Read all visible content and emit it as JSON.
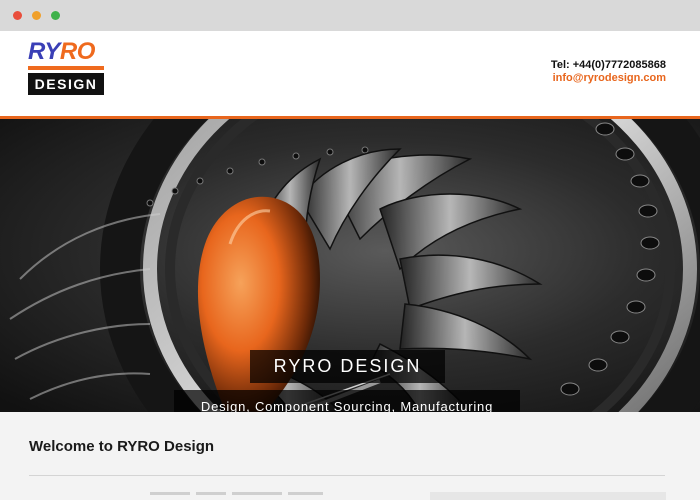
{
  "browser": {
    "buttons": [
      "close",
      "minimize",
      "maximize"
    ]
  },
  "header": {
    "logo": {
      "top_left": "RY",
      "top_right": "RO",
      "bottom": "DESIGN"
    },
    "tel": "Tel: +44(0)7772085868",
    "email": "info@ryrodesign.com"
  },
  "hero": {
    "title": "RYRO DESIGN",
    "subtitle": "Design, Component Sourcing, Manufacturing"
  },
  "main": {
    "heading": "Welcome to RYRO Design"
  },
  "colors": {
    "accent": "#e8661d",
    "logo_blue": "#3a3fb6",
    "dark": "#111111"
  }
}
